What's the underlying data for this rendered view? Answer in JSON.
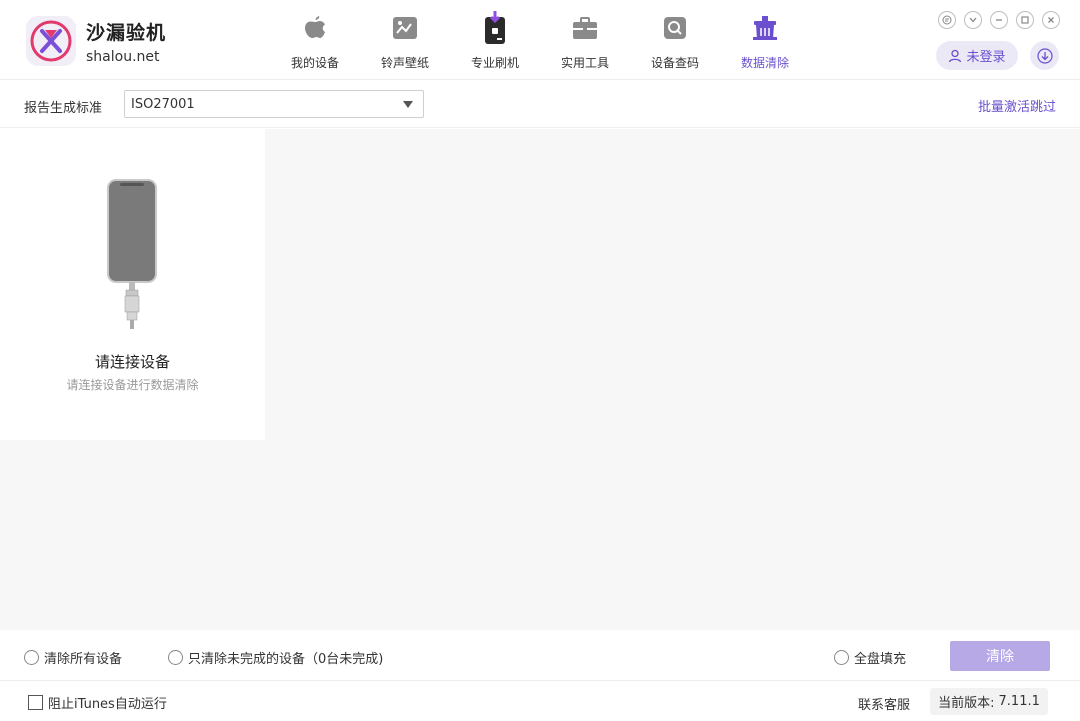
{
  "app": {
    "title": "沙漏验机",
    "subtitle": "shalou.net"
  },
  "nav": [
    {
      "label": "我的设备",
      "icon": "apple-icon",
      "active": false
    },
    {
      "label": "铃声壁纸",
      "icon": "wallpaper-icon",
      "active": false
    },
    {
      "label": "专业刷机",
      "icon": "flash-icon",
      "active": false
    },
    {
      "label": "实用工具",
      "icon": "toolbox-icon",
      "active": false
    },
    {
      "label": "设备查码",
      "icon": "search-icon",
      "active": false
    },
    {
      "label": "数据清除",
      "icon": "clean-icon",
      "active": true
    }
  ],
  "account": {
    "login_label": "未登录"
  },
  "toolbar": {
    "standard_label": "报告生成标准",
    "standard_value": "ISO27001",
    "batch_link": "批量激活跳过"
  },
  "device_card": {
    "title": "请连接设备",
    "subtitle": "请连接设备进行数据清除"
  },
  "actions": {
    "clear_all": "清除所有设备",
    "clear_unfinished": "只清除未完成的设备（0台未完成)",
    "full_fill": "全盘填充",
    "clear_button": "清除"
  },
  "footer": {
    "block_itunes": "阻止iTunes自动运行",
    "support": "联系客服",
    "version_label": "当前版本:",
    "version_value": "7.11.1"
  },
  "colors": {
    "accent": "#6b4fcf",
    "button_disabled": "#b6a9e6",
    "pill_bg": "#ece9f6"
  }
}
